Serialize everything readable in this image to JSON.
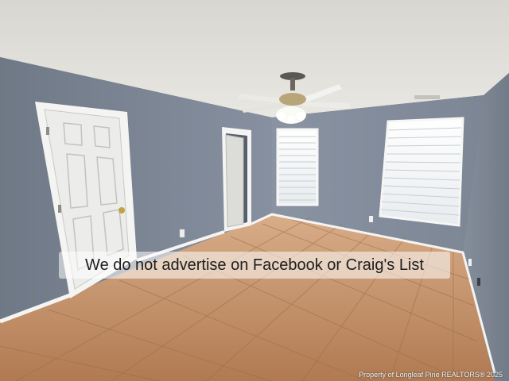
{
  "photo": {
    "scene": "empty bedroom with ceiling fan, two windows with blinds, tile floor"
  },
  "overlay": {
    "notice": "We do not advertise on Facebook or Craig's List",
    "credit": "Property of Longleaf Pine REALTORS® 2025"
  },
  "colors": {
    "wall": "#7d8794",
    "ceiling": "#e6e4df",
    "floor": "#c08a62",
    "trim": "#f4f4f2",
    "door": "#efefec"
  }
}
